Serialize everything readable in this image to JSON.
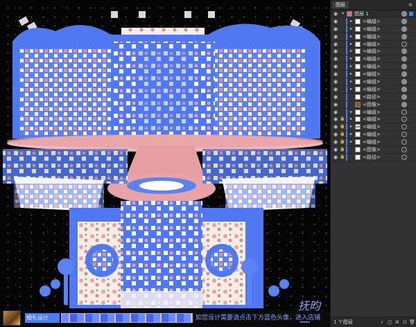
{
  "layers_panel": {
    "tab_label": "图层",
    "top_layer": "图层 1",
    "rows": [
      {
        "label": "<编组>",
        "locked": false,
        "arrow": true,
        "thumb": "light",
        "target": "filled"
      },
      {
        "label": "<编组>",
        "locked": false,
        "arrow": true,
        "thumb": "light",
        "target": "filled"
      },
      {
        "label": "<编组>",
        "locked": false,
        "arrow": true,
        "thumb": "light",
        "target": "filled"
      },
      {
        "label": "<编组>",
        "locked": false,
        "arrow": true,
        "thumb": "light",
        "target": "empty"
      },
      {
        "label": "<编组>",
        "locked": false,
        "arrow": true,
        "thumb": "light",
        "target": "filled"
      },
      {
        "label": "<编组>",
        "locked": false,
        "arrow": true,
        "thumb": "light",
        "target": "filled"
      },
      {
        "label": "<编组>",
        "locked": false,
        "arrow": true,
        "thumb": "light",
        "target": "filled"
      },
      {
        "label": "<编组>",
        "locked": false,
        "arrow": true,
        "thumb": "light",
        "target": "filled"
      },
      {
        "label": "<编组>",
        "locked": false,
        "arrow": true,
        "thumb": "light",
        "target": "filled"
      },
      {
        "label": "<编组>",
        "locked": false,
        "arrow": true,
        "thumb": "light",
        "target": "filled"
      },
      {
        "label": "<路径>",
        "locked": false,
        "arrow": false,
        "thumb": "light",
        "target": "filled"
      },
      {
        "label": "<图像>",
        "locked": false,
        "arrow": false,
        "thumb": "dark",
        "target": "filled"
      },
      {
        "label": "<编组>",
        "locked": false,
        "arrow": true,
        "thumb": "light",
        "target": "empty"
      },
      {
        "label": "<编组>",
        "locked": true,
        "arrow": true,
        "thumb": "light",
        "target": "empty"
      },
      {
        "label": "<编组>",
        "locked": true,
        "arrow": true,
        "thumb": "stripe",
        "target": "empty"
      },
      {
        "label": "<编组>",
        "locked": true,
        "arrow": true,
        "thumb": "light",
        "target": "empty"
      },
      {
        "label": "<编组>",
        "locked": true,
        "arrow": true,
        "thumb": "light",
        "target": "empty"
      },
      {
        "label": "<图像>",
        "locked": true,
        "arrow": false,
        "thumb": "light",
        "target": "empty"
      },
      {
        "label": "<路径>",
        "locked": true,
        "arrow": false,
        "thumb": "light",
        "target": "empty"
      }
    ],
    "footer_count": "1 个图层"
  },
  "canvas": {
    "promo_text": "如您设计需要请点击下方蓝色头像，进入店铺",
    "tag_text": "婚礼设计",
    "signature": "抚昀一"
  },
  "colors": {
    "selection_blue": "#4a7cff",
    "pink": "#e9a3a6",
    "background": "#050505"
  }
}
